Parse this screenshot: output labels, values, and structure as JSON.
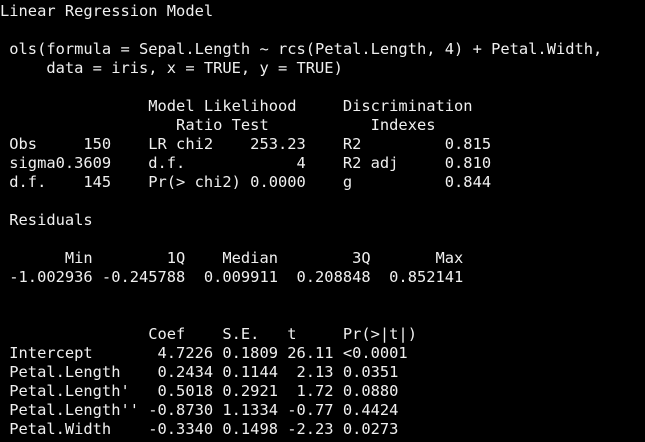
{
  "colors": {
    "background": "#000000",
    "text": "#f0f0f0"
  },
  "console": {
    "lines": [
      "Linear Regression Model",
      "",
      " ols(formula = Sepal.Length ~ rcs(Petal.Length, 4) + Petal.Width,",
      "     data = iris, x = TRUE, y = TRUE)",
      "",
      "                Model Likelihood     Discrimination",
      "                   Ratio Test           Indexes",
      " Obs     150    LR chi2    253.23    R2         0.815",
      " sigma0.3609    d.f.            4    R2 adj     0.810",
      " d.f.    145    Pr(> chi2) 0.0000    g          0.844",
      "",
      " Residuals",
      "",
      "       Min        1Q    Median        3Q       Max",
      " -1.002936 -0.245788  0.009911  0.208848  0.852141",
      "",
      "",
      "                Coef    S.E.   t     Pr(>|t|)",
      " Intercept       4.7226 0.1809 26.11 <0.0001",
      " Petal.Length    0.2434 0.1144  2.13 0.0351",
      " Petal.Length'   0.5018 0.2921  1.72 0.0880",
      " Petal.Length'' -0.8730 1.1334 -0.77 0.4424",
      " Petal.Width    -0.3340 0.1498 -2.23 0.0273",
      ""
    ]
  }
}
